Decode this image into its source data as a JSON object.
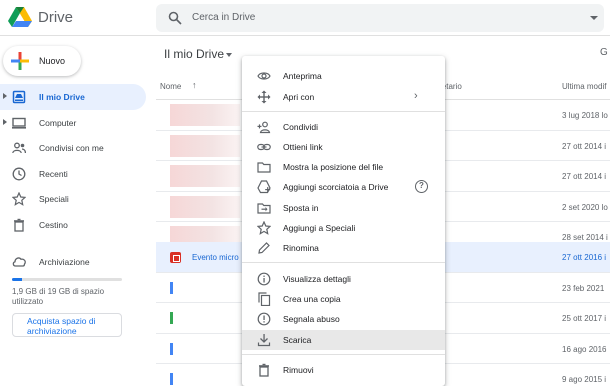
{
  "header": {
    "app_name": "Drive",
    "search_placeholder": "Cerca in Drive"
  },
  "sidebar": {
    "new_label": "Nuovo",
    "items": [
      {
        "label": "Il mio Drive",
        "icon": "my-drive-icon",
        "active": true
      },
      {
        "label": "Computer",
        "icon": "computer-icon"
      },
      {
        "label": "Condivisi con me",
        "icon": "shared-icon"
      },
      {
        "label": "Recenti",
        "icon": "clock-icon"
      },
      {
        "label": "Speciali",
        "icon": "star-icon"
      },
      {
        "label": "Cestino",
        "icon": "trash-icon"
      }
    ],
    "storage": {
      "label": "Archiviazione",
      "used_fraction": 0.09,
      "usage_text": "1,9 GB di 19 GB di spazio utilizzato",
      "buy_label": "Acquista spazio di archiviazione"
    }
  },
  "main": {
    "breadcrumb": "Il mio Drive",
    "top_right_glyph": "G",
    "columns": {
      "name": "Nome",
      "sort_arrow": "↑",
      "owner": "ietario",
      "modified": "Ultima modif"
    },
    "rows": [
      {
        "name": "",
        "date": "3 lug 2018 lo",
        "selected": false
      },
      {
        "name": "",
        "date": "27 ott 2014 i",
        "selected": false
      },
      {
        "name": "",
        "date": "27 ott 2014 i",
        "selected": false
      },
      {
        "name": "",
        "date": "2 set 2020 lo",
        "selected": false
      },
      {
        "name": "",
        "date": "28 set 2014 i",
        "selected": false
      },
      {
        "name": "Evento micro",
        "date": "27 ott 2016 i",
        "selected": true
      },
      {
        "name": "",
        "date": "23 feb 2021",
        "selected": false
      },
      {
        "name": "",
        "date": "25 ott 2017 i",
        "selected": false
      },
      {
        "name": "",
        "date": "16 ago 2016",
        "selected": false
      },
      {
        "name": "",
        "date": "9 ago 2015 i",
        "selected": false
      }
    ]
  },
  "context_menu": {
    "items": [
      {
        "label": "Anteprima",
        "icon": "eye-icon"
      },
      {
        "label": "Apri con",
        "icon": "open-with-icon",
        "submenu": true
      },
      {
        "label": "Condividi",
        "icon": "person-add-icon"
      },
      {
        "label": "Ottieni link",
        "icon": "link-icon"
      },
      {
        "label": "Mostra la posizione del file",
        "icon": "folder-icon"
      },
      {
        "label": "Aggiungi scorciatoia a Drive",
        "icon": "add-shortcut-icon",
        "help": true
      },
      {
        "label": "Sposta in",
        "icon": "move-folder-icon"
      },
      {
        "label": "Aggiungi a Speciali",
        "icon": "star-icon"
      },
      {
        "label": "Rinomina",
        "icon": "pencil-icon"
      },
      {
        "label": "Visualizza dettagli",
        "icon": "info-icon"
      },
      {
        "label": "Crea una copia",
        "icon": "copy-icon"
      },
      {
        "label": "Segnala abuso",
        "icon": "report-icon"
      },
      {
        "label": "Scarica",
        "icon": "download-icon",
        "highlighted": true
      },
      {
        "label": "Rimuovi",
        "icon": "trash-icon"
      }
    ],
    "help_glyph": "?",
    "chevron_glyph": "›"
  },
  "colors": {
    "accent": "#1a73e8",
    "active_bg": "#e8f0fe",
    "selected_text": "#1967d2"
  }
}
